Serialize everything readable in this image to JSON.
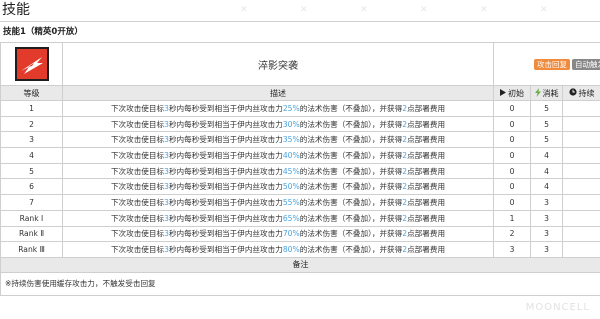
{
  "page": {
    "title": "技能"
  },
  "skill": {
    "subtitle": "技能1（精英0开放）",
    "icon": "skill-icon-red-white",
    "name": "淬影突袭",
    "tags": [
      "攻击回复",
      "自动触发"
    ],
    "colors": {
      "icon_bg": "#e23b2b",
      "tag_recovery": "#f08a3c",
      "tag_trigger": "#888888",
      "highlight": "#4aa3df"
    }
  },
  "table": {
    "headers": {
      "level": "等级",
      "description": "描述",
      "initial": "初始",
      "cost": "消耗",
      "duration": "持续"
    },
    "header_icons": {
      "initial": "play-triangle-icon",
      "cost": "lightning-bolt-icon",
      "duration": "clock-icon"
    },
    "desc_parts": {
      "prefix": "下次攻击使目标",
      "seconds": "3",
      "middle": "秒内每秒受到相当于伊内丝攻击力",
      "suffix": "的法术伤害（不叠加），并获得",
      "points": "2",
      "end": "点部署费用"
    },
    "rows": [
      {
        "level": "1",
        "pct": "25%",
        "initial": "0",
        "cost": "5",
        "duration": ""
      },
      {
        "level": "2",
        "pct": "30%",
        "initial": "0",
        "cost": "5",
        "duration": ""
      },
      {
        "level": "3",
        "pct": "35%",
        "initial": "0",
        "cost": "5",
        "duration": ""
      },
      {
        "level": "4",
        "pct": "40%",
        "initial": "0",
        "cost": "4",
        "duration": ""
      },
      {
        "level": "5",
        "pct": "45%",
        "initial": "0",
        "cost": "4",
        "duration": ""
      },
      {
        "level": "6",
        "pct": "50%",
        "initial": "0",
        "cost": "4",
        "duration": ""
      },
      {
        "level": "7",
        "pct": "55%",
        "initial": "0",
        "cost": "3",
        "duration": ""
      },
      {
        "level": "Rank Ⅰ",
        "pct": "65%",
        "initial": "1",
        "cost": "3",
        "duration": ""
      },
      {
        "level": "Rank Ⅱ",
        "pct": "70%",
        "initial": "2",
        "cost": "3",
        "duration": ""
      },
      {
        "level": "Rank Ⅲ",
        "pct": "80%",
        "initial": "3",
        "cost": "3",
        "duration": ""
      }
    ],
    "remarks_header": "备注",
    "remarks_note": "※持续伤害使用缓存攻击力，不触发受击回复"
  },
  "watermark": "MOONCELL"
}
